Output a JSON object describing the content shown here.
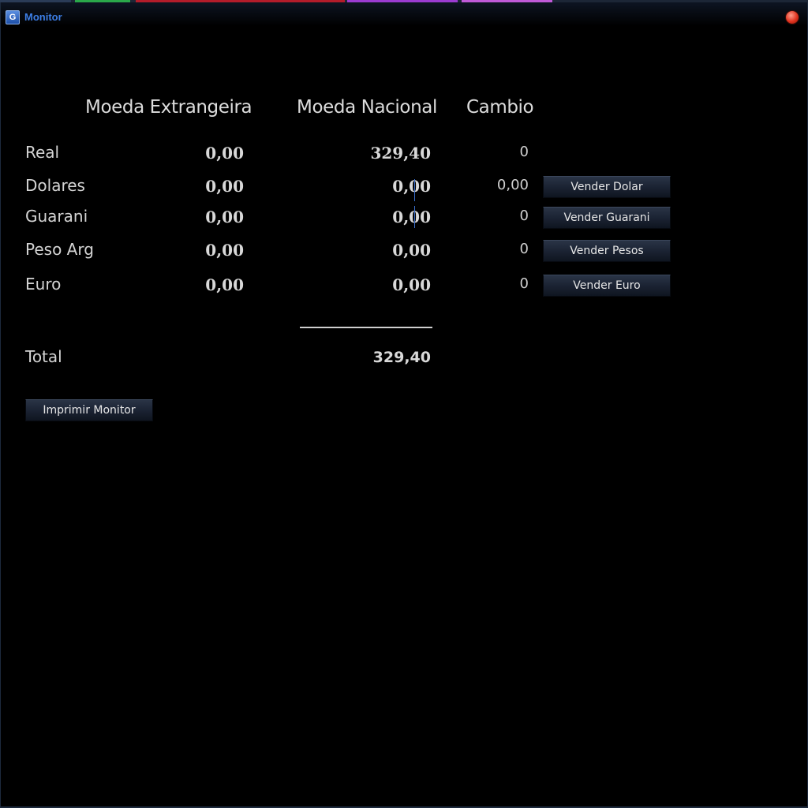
{
  "window": {
    "title": "Monitor",
    "icon_letter": "G",
    "title_color": "#3d7ee6",
    "close_color": "#e0321e"
  },
  "headers": {
    "foreign": "Moeda Extrangeira",
    "national": "Moeda Nacional",
    "rate": "Cambio"
  },
  "rows": [
    {
      "label": "Real",
      "foreign": "0,00",
      "national": "329,40",
      "rate": "0"
    },
    {
      "label": "Dolares",
      "foreign": "0,00",
      "national": "0,00",
      "rate": "0,00",
      "button": "Vender Dolar"
    },
    {
      "label": "Guarani",
      "foreign": "0,00",
      "national": "0,00",
      "rate": "0",
      "button": "Vender Guarani"
    },
    {
      "label": "Peso Arg",
      "foreign": "0,00",
      "national": "0,00",
      "rate": "0",
      "button": "Vender Pesos"
    },
    {
      "label": "Euro",
      "foreign": "0,00",
      "national": "0,00",
      "rate": "0",
      "button": "Vender Euro"
    }
  ],
  "total": {
    "label": "Total",
    "national": "329,40"
  },
  "actions": {
    "print_label": "Imprimir Monitor"
  }
}
